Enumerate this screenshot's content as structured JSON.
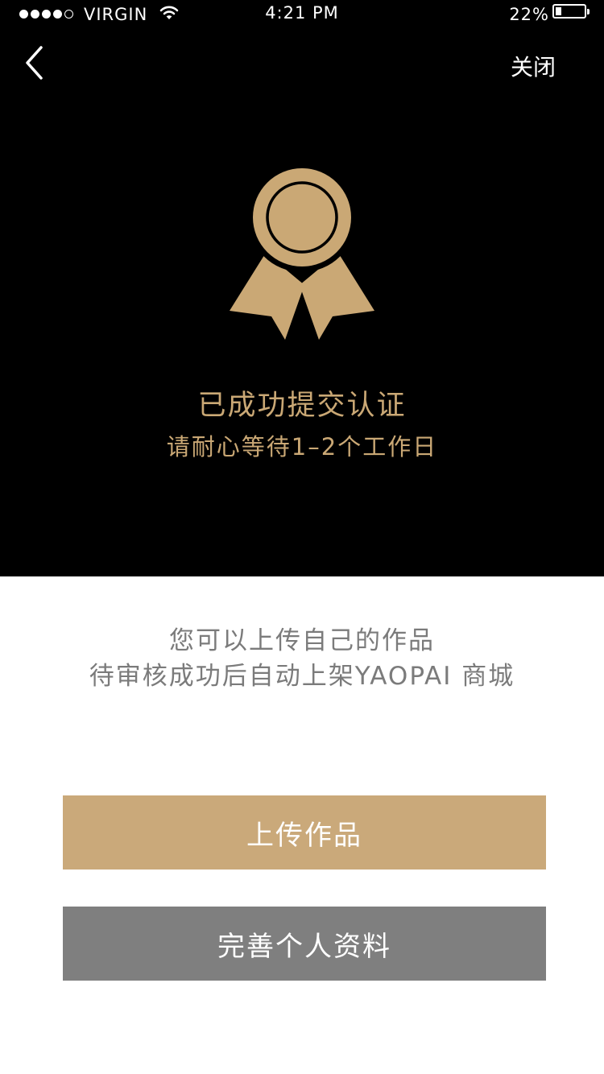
{
  "status_bar": {
    "carrier": "VIRGIN",
    "time": "4:21 PM",
    "battery_percent": "22%",
    "battery_level": 0.22,
    "signal_bars_filled": 4,
    "signal_bars_total": 5
  },
  "nav": {
    "back_icon": "chevron-left-icon",
    "close_label": "关闭"
  },
  "hero": {
    "icon": "award-ribbon-icon",
    "title": "已成功提交认证",
    "subtitle": "请耐心等待1–2个工作日"
  },
  "info": {
    "line1": "您可以上传自己的作品",
    "line2": "待审核成功后自动上架YAOPAI 商城"
  },
  "buttons": {
    "upload_label": "上传作品",
    "profile_label": "完善个人资料"
  },
  "colors": {
    "accent_gold": "#caa97a",
    "secondary_gray": "#7f7f7f",
    "header_bg": "#000000"
  }
}
